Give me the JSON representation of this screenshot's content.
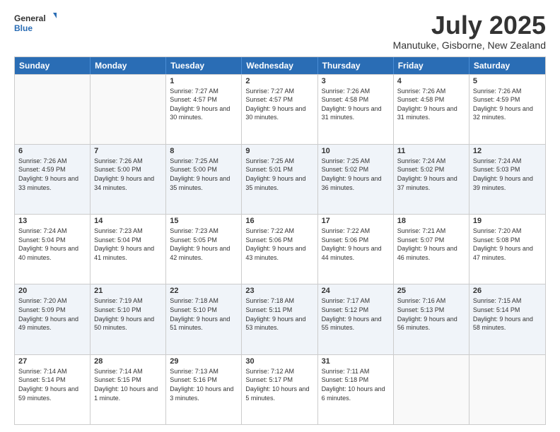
{
  "header": {
    "logo": {
      "general": "General",
      "blue": "Blue"
    },
    "title": "July 2025",
    "subtitle": "Manutuke, Gisborne, New Zealand"
  },
  "calendar": {
    "weekdays": [
      "Sunday",
      "Monday",
      "Tuesday",
      "Wednesday",
      "Thursday",
      "Friday",
      "Saturday"
    ],
    "rows": [
      [
        {
          "day": "",
          "sunrise": "",
          "sunset": "",
          "daylight": "",
          "empty": true
        },
        {
          "day": "",
          "sunrise": "",
          "sunset": "",
          "daylight": "",
          "empty": true
        },
        {
          "day": "1",
          "sunrise": "Sunrise: 7:27 AM",
          "sunset": "Sunset: 4:57 PM",
          "daylight": "Daylight: 9 hours and 30 minutes.",
          "empty": false
        },
        {
          "day": "2",
          "sunrise": "Sunrise: 7:27 AM",
          "sunset": "Sunset: 4:57 PM",
          "daylight": "Daylight: 9 hours and 30 minutes.",
          "empty": false
        },
        {
          "day": "3",
          "sunrise": "Sunrise: 7:26 AM",
          "sunset": "Sunset: 4:58 PM",
          "daylight": "Daylight: 9 hours and 31 minutes.",
          "empty": false
        },
        {
          "day": "4",
          "sunrise": "Sunrise: 7:26 AM",
          "sunset": "Sunset: 4:58 PM",
          "daylight": "Daylight: 9 hours and 31 minutes.",
          "empty": false
        },
        {
          "day": "5",
          "sunrise": "Sunrise: 7:26 AM",
          "sunset": "Sunset: 4:59 PM",
          "daylight": "Daylight: 9 hours and 32 minutes.",
          "empty": false
        }
      ],
      [
        {
          "day": "6",
          "sunrise": "Sunrise: 7:26 AM",
          "sunset": "Sunset: 4:59 PM",
          "daylight": "Daylight: 9 hours and 33 minutes.",
          "empty": false
        },
        {
          "day": "7",
          "sunrise": "Sunrise: 7:26 AM",
          "sunset": "Sunset: 5:00 PM",
          "daylight": "Daylight: 9 hours and 34 minutes.",
          "empty": false
        },
        {
          "day": "8",
          "sunrise": "Sunrise: 7:25 AM",
          "sunset": "Sunset: 5:00 PM",
          "daylight": "Daylight: 9 hours and 35 minutes.",
          "empty": false
        },
        {
          "day": "9",
          "sunrise": "Sunrise: 7:25 AM",
          "sunset": "Sunset: 5:01 PM",
          "daylight": "Daylight: 9 hours and 35 minutes.",
          "empty": false
        },
        {
          "day": "10",
          "sunrise": "Sunrise: 7:25 AM",
          "sunset": "Sunset: 5:02 PM",
          "daylight": "Daylight: 9 hours and 36 minutes.",
          "empty": false
        },
        {
          "day": "11",
          "sunrise": "Sunrise: 7:24 AM",
          "sunset": "Sunset: 5:02 PM",
          "daylight": "Daylight: 9 hours and 37 minutes.",
          "empty": false
        },
        {
          "day": "12",
          "sunrise": "Sunrise: 7:24 AM",
          "sunset": "Sunset: 5:03 PM",
          "daylight": "Daylight: 9 hours and 39 minutes.",
          "empty": false
        }
      ],
      [
        {
          "day": "13",
          "sunrise": "Sunrise: 7:24 AM",
          "sunset": "Sunset: 5:04 PM",
          "daylight": "Daylight: 9 hours and 40 minutes.",
          "empty": false
        },
        {
          "day": "14",
          "sunrise": "Sunrise: 7:23 AM",
          "sunset": "Sunset: 5:04 PM",
          "daylight": "Daylight: 9 hours and 41 minutes.",
          "empty": false
        },
        {
          "day": "15",
          "sunrise": "Sunrise: 7:23 AM",
          "sunset": "Sunset: 5:05 PM",
          "daylight": "Daylight: 9 hours and 42 minutes.",
          "empty": false
        },
        {
          "day": "16",
          "sunrise": "Sunrise: 7:22 AM",
          "sunset": "Sunset: 5:06 PM",
          "daylight": "Daylight: 9 hours and 43 minutes.",
          "empty": false
        },
        {
          "day": "17",
          "sunrise": "Sunrise: 7:22 AM",
          "sunset": "Sunset: 5:06 PM",
          "daylight": "Daylight: 9 hours and 44 minutes.",
          "empty": false
        },
        {
          "day": "18",
          "sunrise": "Sunrise: 7:21 AM",
          "sunset": "Sunset: 5:07 PM",
          "daylight": "Daylight: 9 hours and 46 minutes.",
          "empty": false
        },
        {
          "day": "19",
          "sunrise": "Sunrise: 7:20 AM",
          "sunset": "Sunset: 5:08 PM",
          "daylight": "Daylight: 9 hours and 47 minutes.",
          "empty": false
        }
      ],
      [
        {
          "day": "20",
          "sunrise": "Sunrise: 7:20 AM",
          "sunset": "Sunset: 5:09 PM",
          "daylight": "Daylight: 9 hours and 49 minutes.",
          "empty": false
        },
        {
          "day": "21",
          "sunrise": "Sunrise: 7:19 AM",
          "sunset": "Sunset: 5:10 PM",
          "daylight": "Daylight: 9 hours and 50 minutes.",
          "empty": false
        },
        {
          "day": "22",
          "sunrise": "Sunrise: 7:18 AM",
          "sunset": "Sunset: 5:10 PM",
          "daylight": "Daylight: 9 hours and 51 minutes.",
          "empty": false
        },
        {
          "day": "23",
          "sunrise": "Sunrise: 7:18 AM",
          "sunset": "Sunset: 5:11 PM",
          "daylight": "Daylight: 9 hours and 53 minutes.",
          "empty": false
        },
        {
          "day": "24",
          "sunrise": "Sunrise: 7:17 AM",
          "sunset": "Sunset: 5:12 PM",
          "daylight": "Daylight: 9 hours and 55 minutes.",
          "empty": false
        },
        {
          "day": "25",
          "sunrise": "Sunrise: 7:16 AM",
          "sunset": "Sunset: 5:13 PM",
          "daylight": "Daylight: 9 hours and 56 minutes.",
          "empty": false
        },
        {
          "day": "26",
          "sunrise": "Sunrise: 7:15 AM",
          "sunset": "Sunset: 5:14 PM",
          "daylight": "Daylight: 9 hours and 58 minutes.",
          "empty": false
        }
      ],
      [
        {
          "day": "27",
          "sunrise": "Sunrise: 7:14 AM",
          "sunset": "Sunset: 5:14 PM",
          "daylight": "Daylight: 9 hours and 59 minutes.",
          "empty": false
        },
        {
          "day": "28",
          "sunrise": "Sunrise: 7:14 AM",
          "sunset": "Sunset: 5:15 PM",
          "daylight": "Daylight: 10 hours and 1 minute.",
          "empty": false
        },
        {
          "day": "29",
          "sunrise": "Sunrise: 7:13 AM",
          "sunset": "Sunset: 5:16 PM",
          "daylight": "Daylight: 10 hours and 3 minutes.",
          "empty": false
        },
        {
          "day": "30",
          "sunrise": "Sunrise: 7:12 AM",
          "sunset": "Sunset: 5:17 PM",
          "daylight": "Daylight: 10 hours and 5 minutes.",
          "empty": false
        },
        {
          "day": "31",
          "sunrise": "Sunrise: 7:11 AM",
          "sunset": "Sunset: 5:18 PM",
          "daylight": "Daylight: 10 hours and 6 minutes.",
          "empty": false
        },
        {
          "day": "",
          "sunrise": "",
          "sunset": "",
          "daylight": "",
          "empty": true
        },
        {
          "day": "",
          "sunrise": "",
          "sunset": "",
          "daylight": "",
          "empty": true
        }
      ]
    ]
  }
}
